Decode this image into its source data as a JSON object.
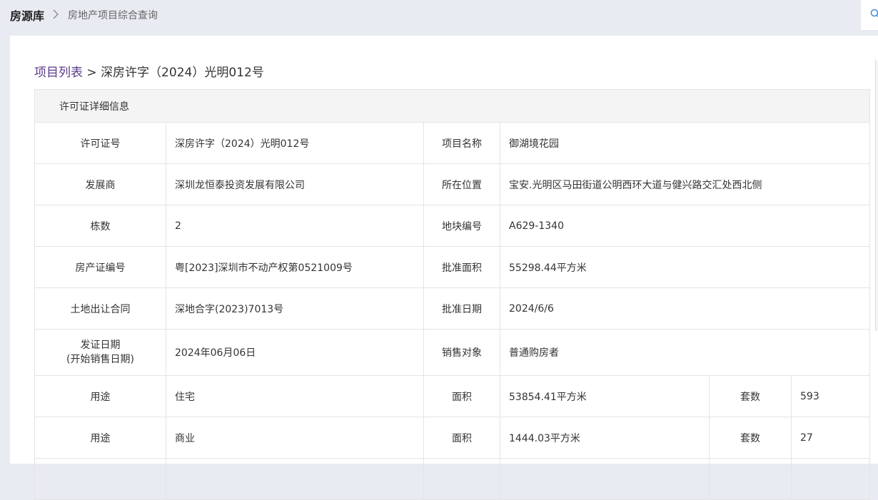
{
  "breadcrumb": {
    "root": "房源库",
    "current": "房地产项目综合查询"
  },
  "title": {
    "link": "项目列表",
    "separator": ">",
    "current": "深房许字（2024）光明012号"
  },
  "table": {
    "header": "许可证详细信息",
    "rows": [
      {
        "l1": "许可证号",
        "v1": "深房许字（2024）光明012号",
        "l2": "项目名称",
        "v2": "御湖境花园"
      },
      {
        "l1": "发展商",
        "v1": "深圳龙恒泰投资发展有限公司",
        "l2": "所在位置",
        "v2": "宝安.光明区马田街道公明西环大道与健兴路交汇处西北侧"
      },
      {
        "l1": "栋数",
        "v1": "2",
        "l2": "地块编号",
        "v2": "A629-1340"
      },
      {
        "l1": "房产证编号",
        "v1": "粤[2023]深圳市不动产权第0521009号",
        "l2": "批准面积",
        "v2": "55298.44平方米"
      },
      {
        "l1": "土地出让合同",
        "v1": "深地合字(2023)7013号",
        "l2": "批准日期",
        "v2": "2024/6/6"
      },
      {
        "l1a": "发证日期",
        "l1b": "(开始销售日期)",
        "v1": "2024年06月06日",
        "l2": "销售对象",
        "v2": "普通购房者"
      }
    ],
    "usage_rows": [
      {
        "l1": "用途",
        "v1": "住宅",
        "l2": "面积",
        "v2": "53854.41平方米",
        "l3": "套数",
        "v3": "593"
      },
      {
        "l1": "用途",
        "v1": "商业",
        "l2": "面积",
        "v2": "1444.03平方米",
        "l3": "套数",
        "v3": "27"
      }
    ]
  },
  "icons": {
    "breadcrumb_separator": "chevron-right-icon",
    "search": "search-icon"
  },
  "colors": {
    "page_bg": "#e9ebf2",
    "link": "#5b3a8a",
    "header_bg": "#f4f4f4",
    "border": "#e4e4e4"
  }
}
